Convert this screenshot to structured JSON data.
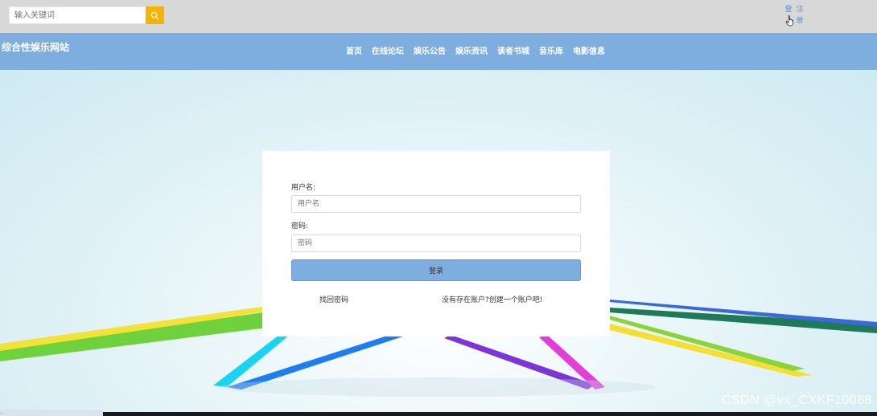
{
  "search": {
    "placeholder": "输入关键词"
  },
  "auth": {
    "login_label": "登",
    "register_label": "注",
    "register_label_2": "册"
  },
  "site": {
    "title": "综合性娱乐网站"
  },
  "nav": {
    "items": [
      {
        "label": "首页"
      },
      {
        "label": "在线论坛"
      },
      {
        "label": "娱乐公告"
      },
      {
        "label": "娱乐资讯"
      },
      {
        "label": "读者书城"
      },
      {
        "label": "音乐库"
      },
      {
        "label": "电影信息"
      }
    ]
  },
  "login": {
    "username_label": "用户名:",
    "username_placeholder": "用户名",
    "password_label": "密码:",
    "password_placeholder": "密码",
    "submit_label": "登录",
    "forgot_link": "找回密码",
    "register_link": "没有存在账户?创建一个账户吧!"
  },
  "watermark": "CSDN @vx_CXKF10088",
  "status_bar": {
    "url": "...",
    "colors": {
      "navbar": "#7eaee0",
      "topbar": "#d8d8d8",
      "search_button": "#f4b400",
      "login_button": "#7eaee0"
    }
  }
}
